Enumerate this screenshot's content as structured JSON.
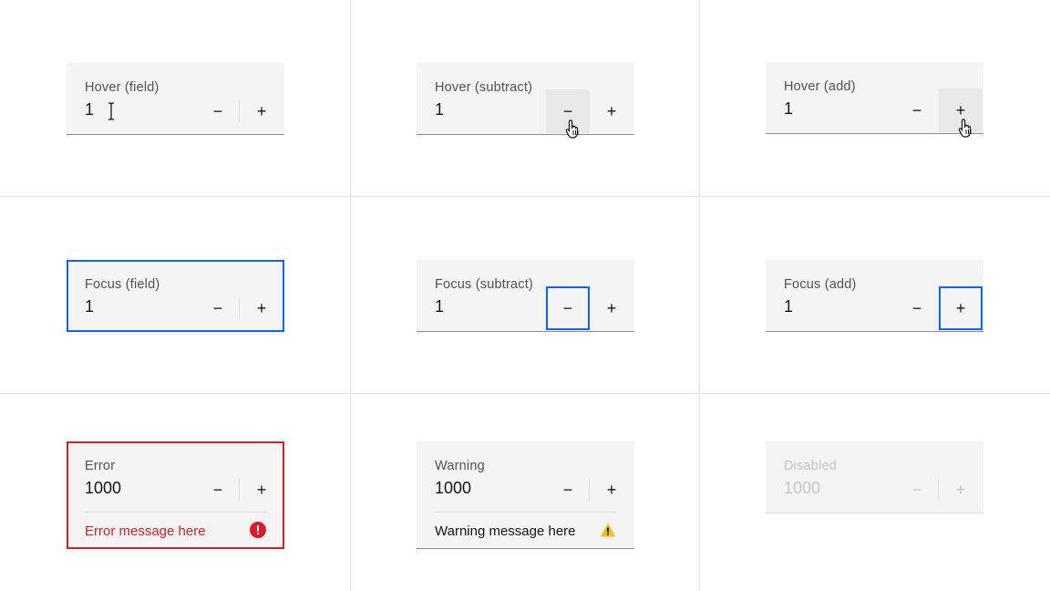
{
  "cells": {
    "hover_field": {
      "label": "Hover (field)",
      "value": "1",
      "minus": "−",
      "plus": "+"
    },
    "hover_subtract": {
      "label": "Hover (subtract)",
      "value": "1",
      "minus": "−",
      "plus": "+"
    },
    "hover_add": {
      "label": "Hover (add)",
      "value": "1",
      "minus": "−",
      "plus": "+"
    },
    "focus_field": {
      "label": "Focus (field)",
      "value": "1",
      "minus": "−",
      "plus": "+"
    },
    "focus_subtract": {
      "label": "Focus (subtract)",
      "value": "1",
      "minus": "−",
      "plus": "+"
    },
    "focus_add": {
      "label": "Focus (add)",
      "value": "1",
      "minus": "−",
      "plus": "+"
    },
    "error": {
      "label": "Error",
      "value": "1000",
      "minus": "−",
      "plus": "+",
      "message": "Error message here"
    },
    "warning": {
      "label": "Warning",
      "value": "1000",
      "minus": "−",
      "plus": "+",
      "message": "Warning message here"
    },
    "disabled": {
      "label": "Disabled",
      "value": "1000",
      "minus": "−",
      "plus": "+"
    }
  },
  "icons": {
    "error": "error-filled-icon",
    "warning": "warning-filled-icon",
    "text_cursor": "i-beam-cursor-icon",
    "pointer_cursor": "hand-pointer-cursor-icon"
  },
  "colors": {
    "focus": "#0f62fe",
    "error": "#da1e28",
    "warning": "#f1c21b",
    "field_bg": "#f4f4f4",
    "hover_bg": "#e8e8e8",
    "grid_line": "#e0e0e0",
    "disabled_text": "#c6c6c6"
  }
}
